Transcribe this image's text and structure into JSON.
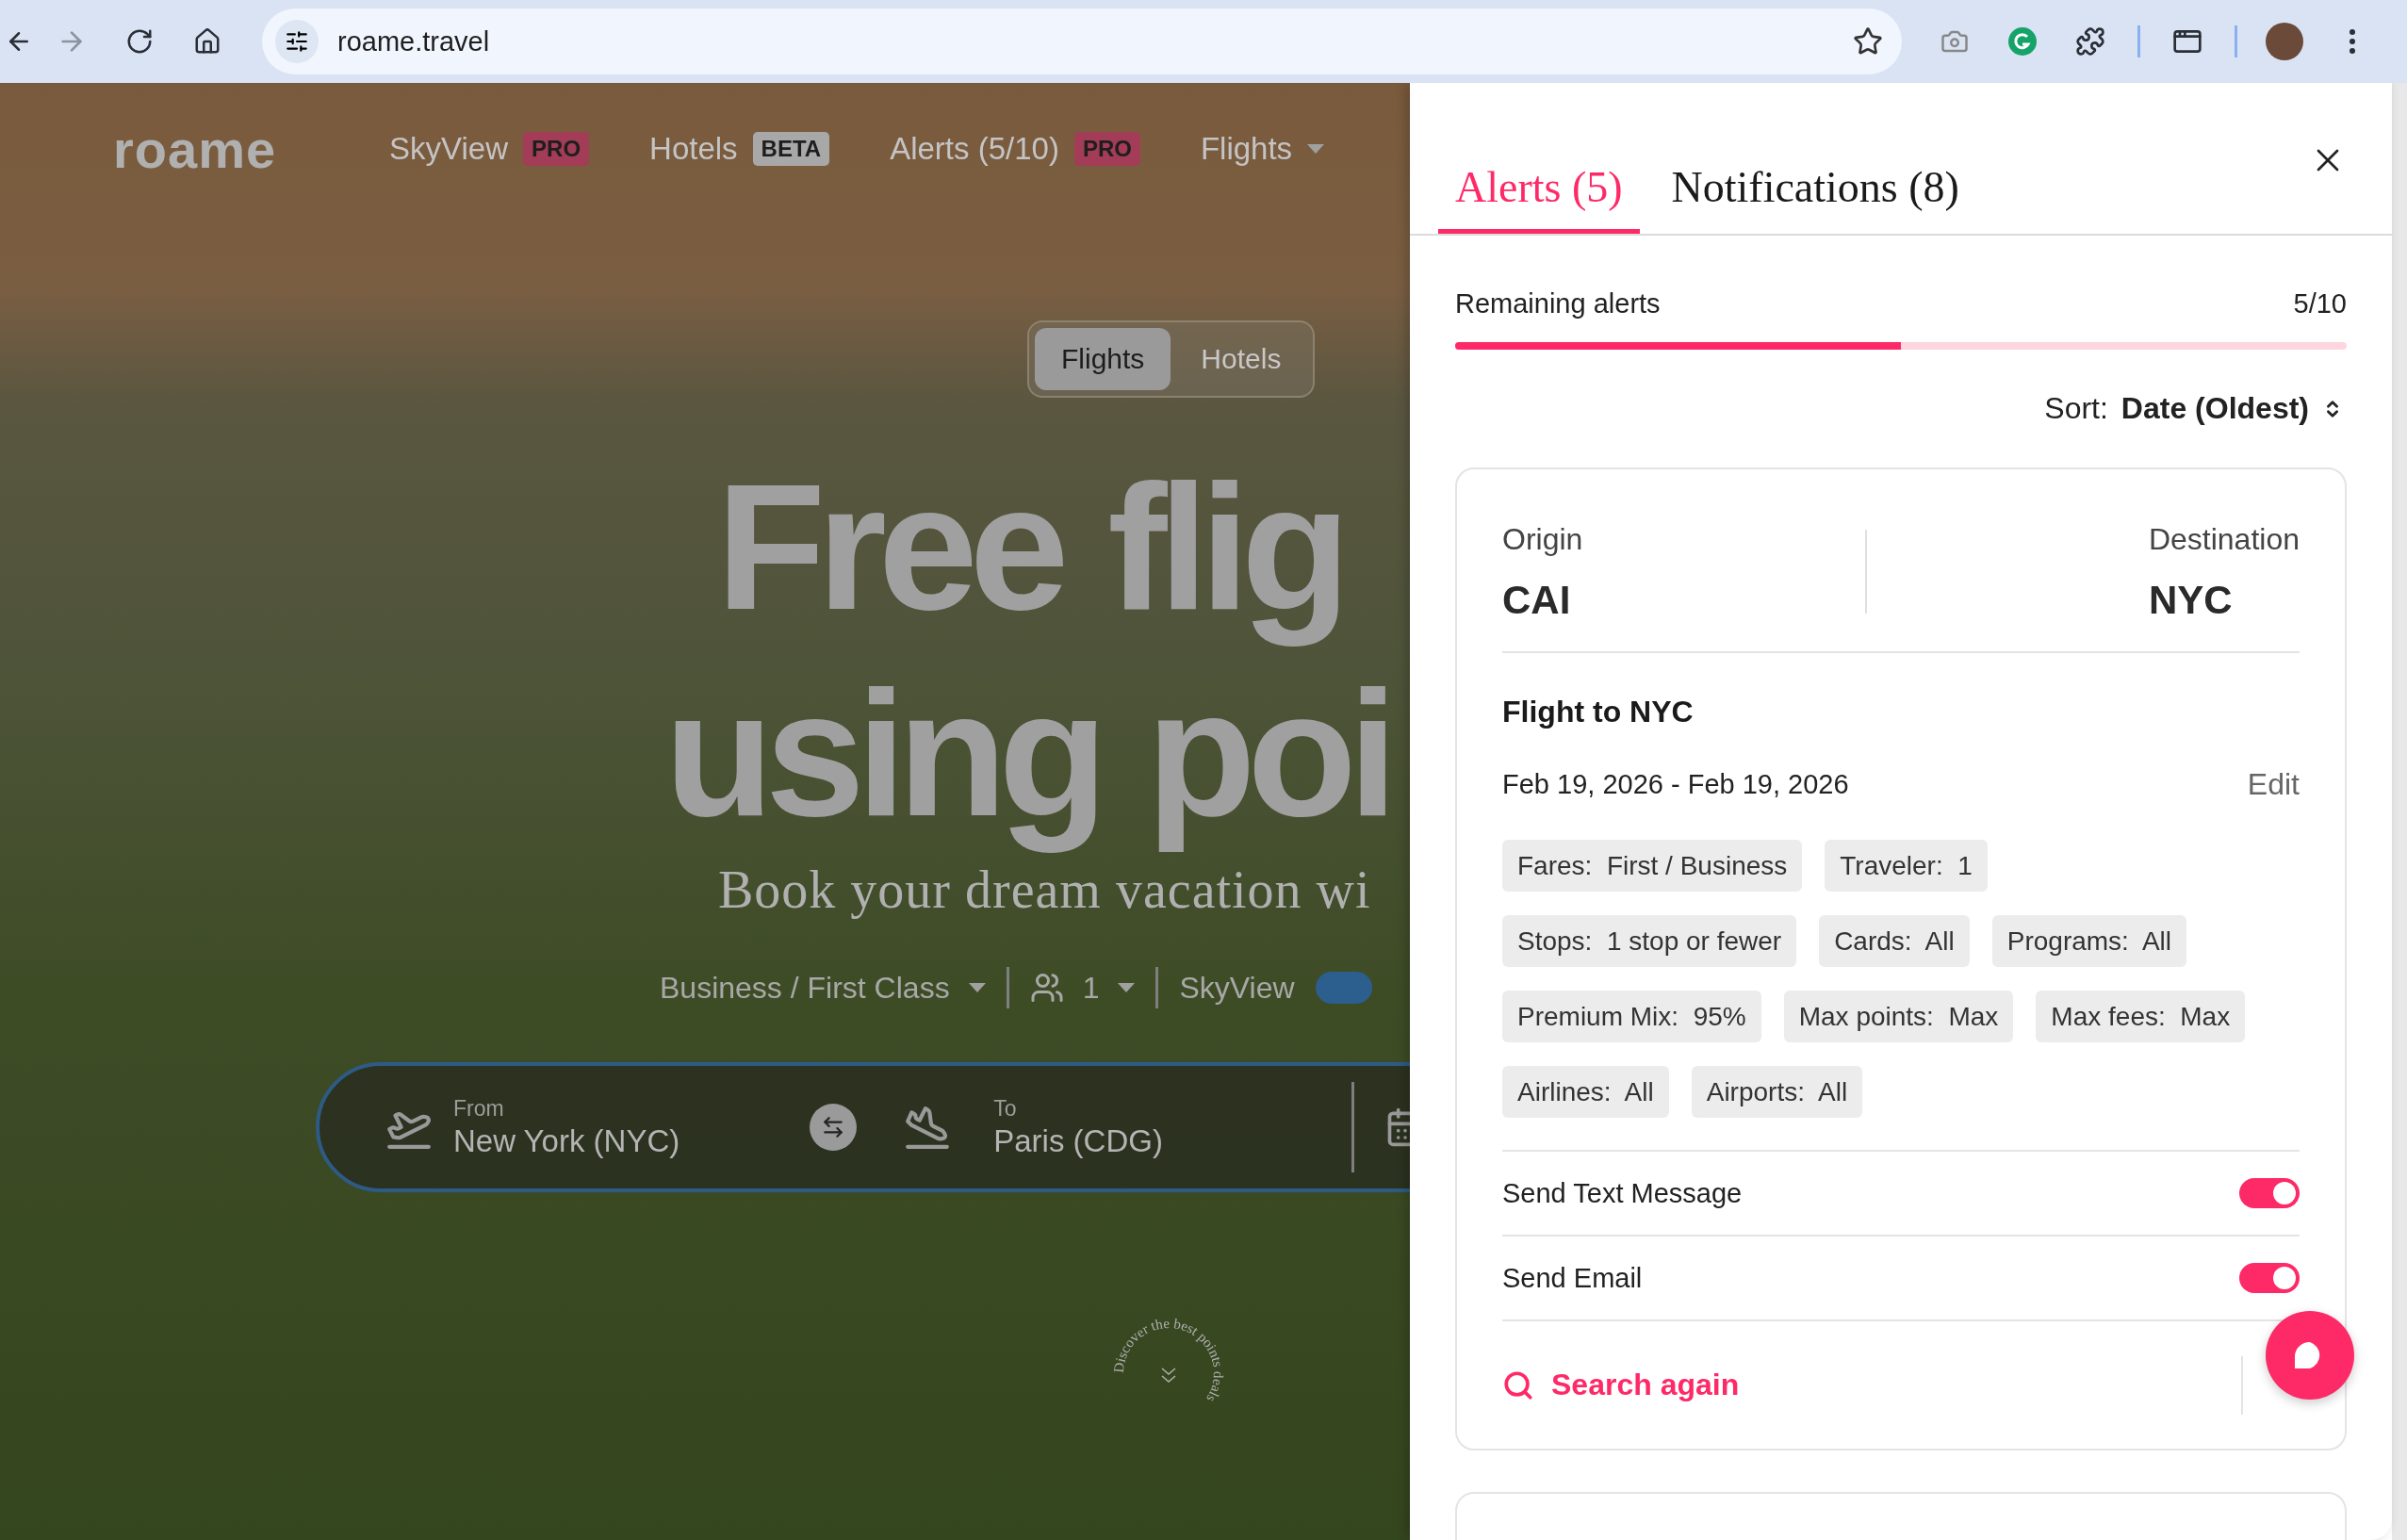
{
  "browser": {
    "address": "roame.travel"
  },
  "site": {
    "logo": "roame",
    "nav": [
      {
        "label": "SkyView",
        "badge": "PRO",
        "kind": "pro"
      },
      {
        "label": "Hotels",
        "badge": "BETA",
        "kind": "beta"
      },
      {
        "label": "Alerts (5/10)",
        "badge": "PRO",
        "kind": "pro"
      },
      {
        "label": "Flights",
        "kind": "dropdown"
      }
    ],
    "mode_tabs": [
      {
        "label": "Flights",
        "selected": true
      },
      {
        "label": "Hotels",
        "selected": false
      }
    ],
    "headline": [
      "Free flig",
      "using poi"
    ],
    "subtitle": "Book your dream vacation wi",
    "options": {
      "cabin": "Business / First Class",
      "travelers": "1",
      "skyview": "SkyView",
      "skyview_on": true
    },
    "search": {
      "from_label": "From",
      "from": "New York (NYC)",
      "to_label": "To",
      "to": "Paris (CDG)"
    },
    "discover": "Discover the best points deals"
  },
  "panel": {
    "tabs": [
      {
        "label": "Alerts (5)",
        "selected": true
      },
      {
        "label": "Notifications (8)",
        "selected": false
      }
    ],
    "remaining": {
      "label": "Remaining alerts",
      "value": "5/10",
      "level": 0.5
    },
    "sort": {
      "label": "Sort:",
      "value": "Date (Oldest)"
    },
    "alert": {
      "origin_label": "Origin",
      "origin": "CAI",
      "destination_label": "Destination",
      "destination": "NYC",
      "title": "Flight to NYC",
      "dates": "Feb 19, 2026 - Feb 19, 2026",
      "edit": "Edit",
      "chips": [
        "Fares:  First / Business",
        "Traveler:  1",
        "Stops:  1 stop or fewer",
        "Cards:  All",
        "Programs:  All",
        "Premium Mix:  95%",
        "Max points:  Max",
        "Max fees:  Max",
        "Airlines:  All",
        "Airports:  All"
      ],
      "toggles": [
        {
          "label": "Send Text Message",
          "on": true
        },
        {
          "label": "Send Email",
          "on": true
        }
      ],
      "search_again": "Search again"
    }
  }
}
